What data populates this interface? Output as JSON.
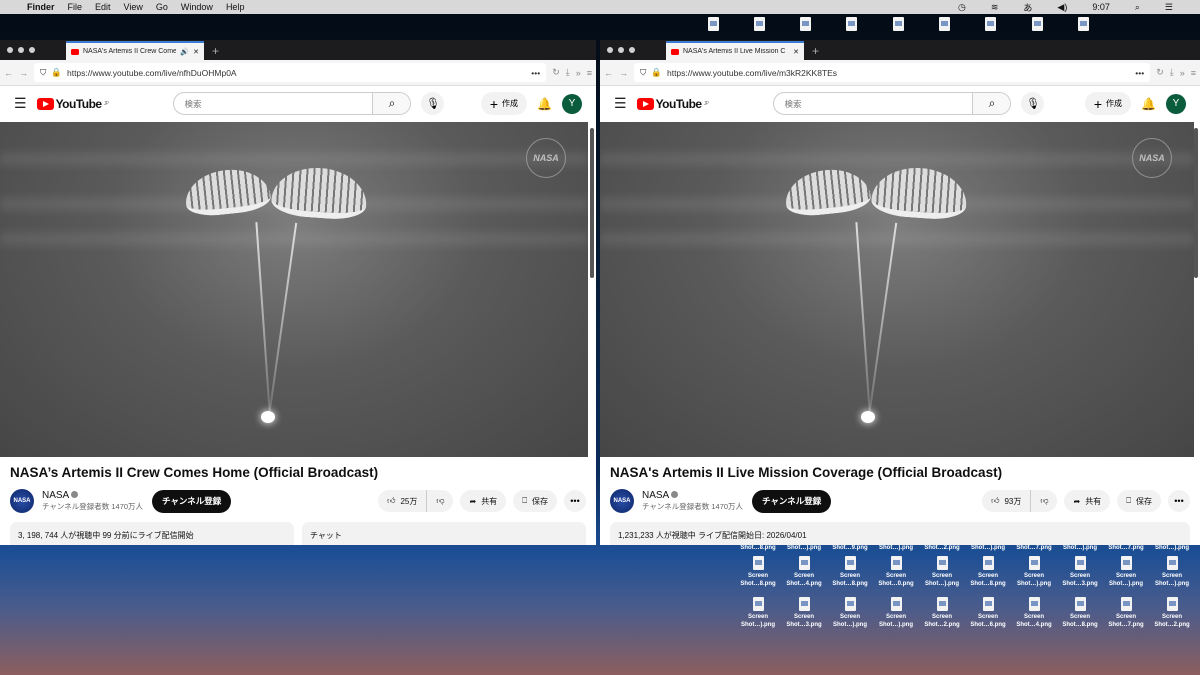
{
  "menubar": {
    "apple": "",
    "app": "Finder",
    "items": [
      "File",
      "Edit",
      "View",
      "Go",
      "Window",
      "Help"
    ],
    "clock": "9:07"
  },
  "desktop": {
    "top_icons": 9,
    "row_labels_partial": [
      "Shot…8.png",
      "Shot…).png",
      "Shot…9.png",
      "Shot…).png",
      "Shot…2.png",
      "Shot…).png",
      "Shot…7.png",
      "Shot…).png",
      "Shot…7.png",
      "Shot…).png"
    ],
    "row1": [
      "Shot…8.png",
      "Shot…4.png",
      "Shot…8.png",
      "Shot…0.png",
      "Shot…).png",
      "Shot…8.png",
      "Shot…).png",
      "Shot…3.png",
      "Shot…).png",
      "Shot…).png"
    ],
    "row2": [
      "Shot…).png",
      "Shot…3.png",
      "Shot…).png",
      "Shot…).png",
      "Shot…2.png",
      "Shot…6.png",
      "Shot…4.png",
      "Shot…8.png",
      "Shot…7.png",
      "Shot…2.png"
    ],
    "icon_name": "Screen"
  },
  "windows": [
    {
      "tab_title": "NASA's Artemis II Crew Comes Home (Official Broadcast) - YouTube",
      "tab_audio": "🔊",
      "url": "https://www.youtube.com/live/nfhDuOHMp0A",
      "logo": "YouTube",
      "region": "JP",
      "search_placeholder": "検索",
      "create": "作成",
      "avatar": "Y",
      "watermark": "NASA",
      "title": "NASA’s Artemis II Crew Comes Home (Official Broadcast)",
      "channel": "NASA",
      "subs": "チャンネル登録者数 1470万人",
      "subscribe": "チャンネル登録",
      "likes": "25万",
      "share": "共有",
      "save": "保存",
      "more": "•••",
      "desc": "3, 198, 744 人が視聴中  99 分前にライブ配信開始",
      "chat": "チャット"
    },
    {
      "tab_title": "NASA's Artemis II Live Mission Coverage (Official Broadcast) - YouTube",
      "tab_audio": "",
      "url": "https://www.youtube.com/live/m3kR2KK8TEs",
      "logo": "YouTube",
      "region": "JP",
      "search_placeholder": "検索",
      "create": "作成",
      "avatar": "Y",
      "watermark": "NASA",
      "title": "NASA's Artemis II Live Mission Coverage (Official Broadcast)",
      "channel": "NASA",
      "subs": "チャンネル登録者数 1470万人",
      "subscribe": "チャンネル登録",
      "likes": "93万",
      "share": "共有",
      "save": "保存",
      "more": "•••",
      "desc": "1,231,233 人が視聴中  ライブ配信開始日: 2026/04/01",
      "chat": ""
    }
  ]
}
